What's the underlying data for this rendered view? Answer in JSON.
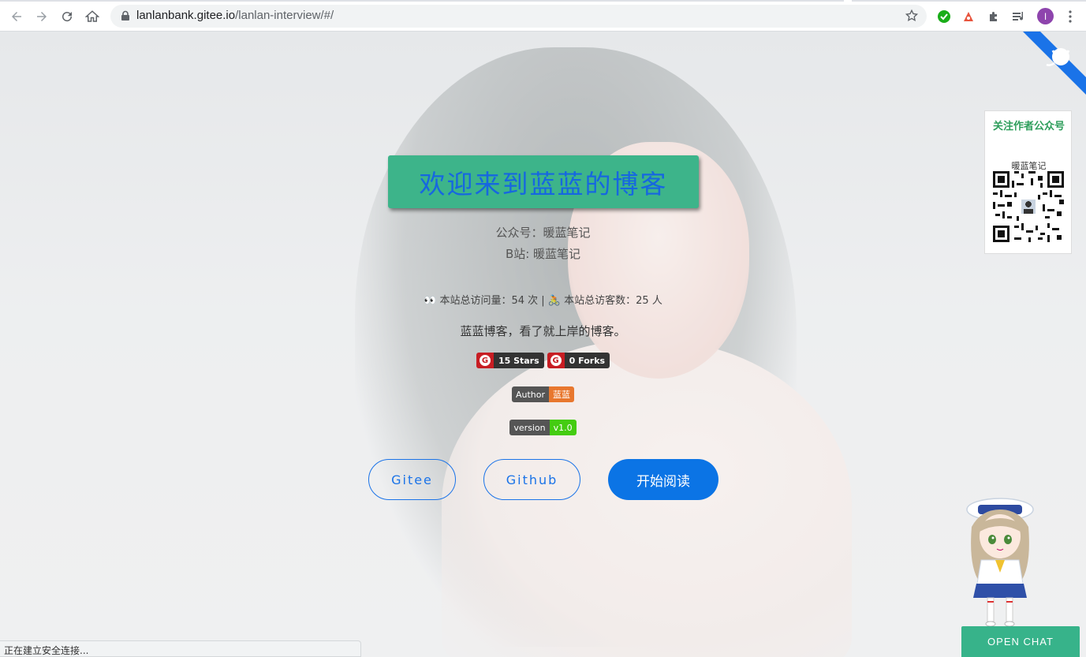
{
  "browser": {
    "url_host": "lanlanbank.gitee.io",
    "url_path": "/lanlan-interview/#/",
    "profile_initial": "I",
    "status_text": "正在建立安全连接..."
  },
  "hero": {
    "welcome": "欢迎来到蓝蓝的博客",
    "wechat_line": "公众号：暖蓝笔记",
    "bili_line": "B站: 暖蓝笔记",
    "stats_visits": "本站总访问量：54 次 | ",
    "stats_visitors": "本站总访客数：25 人",
    "tagline": "蓝蓝博客，看了就上岸的博客。"
  },
  "badges": {
    "stars": "15 Stars",
    "forks": "0 Forks",
    "author_label": "Author",
    "author_value": "蓝蓝",
    "version_label": "version",
    "version_value": "v1.0"
  },
  "buttons": {
    "gitee": "Gitee",
    "github": "Github",
    "start": "开始阅读"
  },
  "qr": {
    "title": "关注作者公众号",
    "name": "暖蓝笔记"
  },
  "chat": {
    "label": "OPEN CHAT"
  },
  "colors": {
    "accent": "#0b74e5",
    "welcome_bg": "#3db48a",
    "welcome_text": "#1667e0",
    "chat_bg": "#37b38a"
  }
}
